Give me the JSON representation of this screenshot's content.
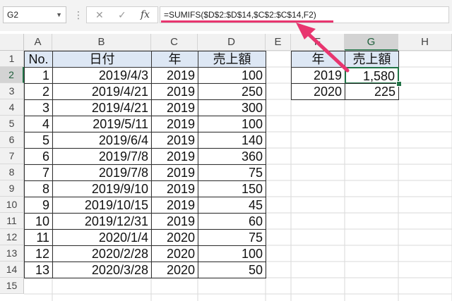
{
  "name_box": "G2",
  "formula": "=SUMIFS($D$2:$D$14,$C$2:$C$14,F2)",
  "columns": [
    "A",
    "B",
    "C",
    "D",
    "E",
    "F",
    "G",
    "H"
  ],
  "row_numbers": [
    "1",
    "2",
    "3",
    "4",
    "5",
    "6",
    "7",
    "8",
    "9",
    "10",
    "11",
    "12",
    "13",
    "14",
    "15"
  ],
  "table_headers": {
    "no": "No.",
    "date": "日付",
    "year": "年",
    "sales": "売上額"
  },
  "rows": [
    {
      "no": "1",
      "date": "2019/4/3",
      "year": "2019",
      "sales": "100"
    },
    {
      "no": "2",
      "date": "2019/4/21",
      "year": "2019",
      "sales": "250"
    },
    {
      "no": "3",
      "date": "2019/4/21",
      "year": "2019",
      "sales": "300"
    },
    {
      "no": "4",
      "date": "2019/5/11",
      "year": "2019",
      "sales": "100"
    },
    {
      "no": "5",
      "date": "2019/6/4",
      "year": "2019",
      "sales": "140"
    },
    {
      "no": "6",
      "date": "2019/7/8",
      "year": "2019",
      "sales": "360"
    },
    {
      "no": "7",
      "date": "2019/7/8",
      "year": "2019",
      "sales": "75"
    },
    {
      "no": "8",
      "date": "2019/9/10",
      "year": "2019",
      "sales": "150"
    },
    {
      "no": "9",
      "date": "2019/10/15",
      "year": "2019",
      "sales": "45"
    },
    {
      "no": "10",
      "date": "2019/12/31",
      "year": "2019",
      "sales": "60"
    },
    {
      "no": "11",
      "date": "2020/1/4",
      "year": "2020",
      "sales": "75"
    },
    {
      "no": "12",
      "date": "2020/2/28",
      "year": "2020",
      "sales": "100"
    },
    {
      "no": "13",
      "date": "2020/3/28",
      "year": "2020",
      "sales": "50"
    }
  ],
  "summary_headers": {
    "year": "年",
    "sales": "売上額"
  },
  "summary_rows": [
    {
      "year": "2019",
      "sales": "1,580"
    },
    {
      "year": "2020",
      "sales": "225"
    }
  ],
  "colors": {
    "header_fill": "#dde7f4",
    "selection": "#217346",
    "annotation": "#e8356f"
  }
}
